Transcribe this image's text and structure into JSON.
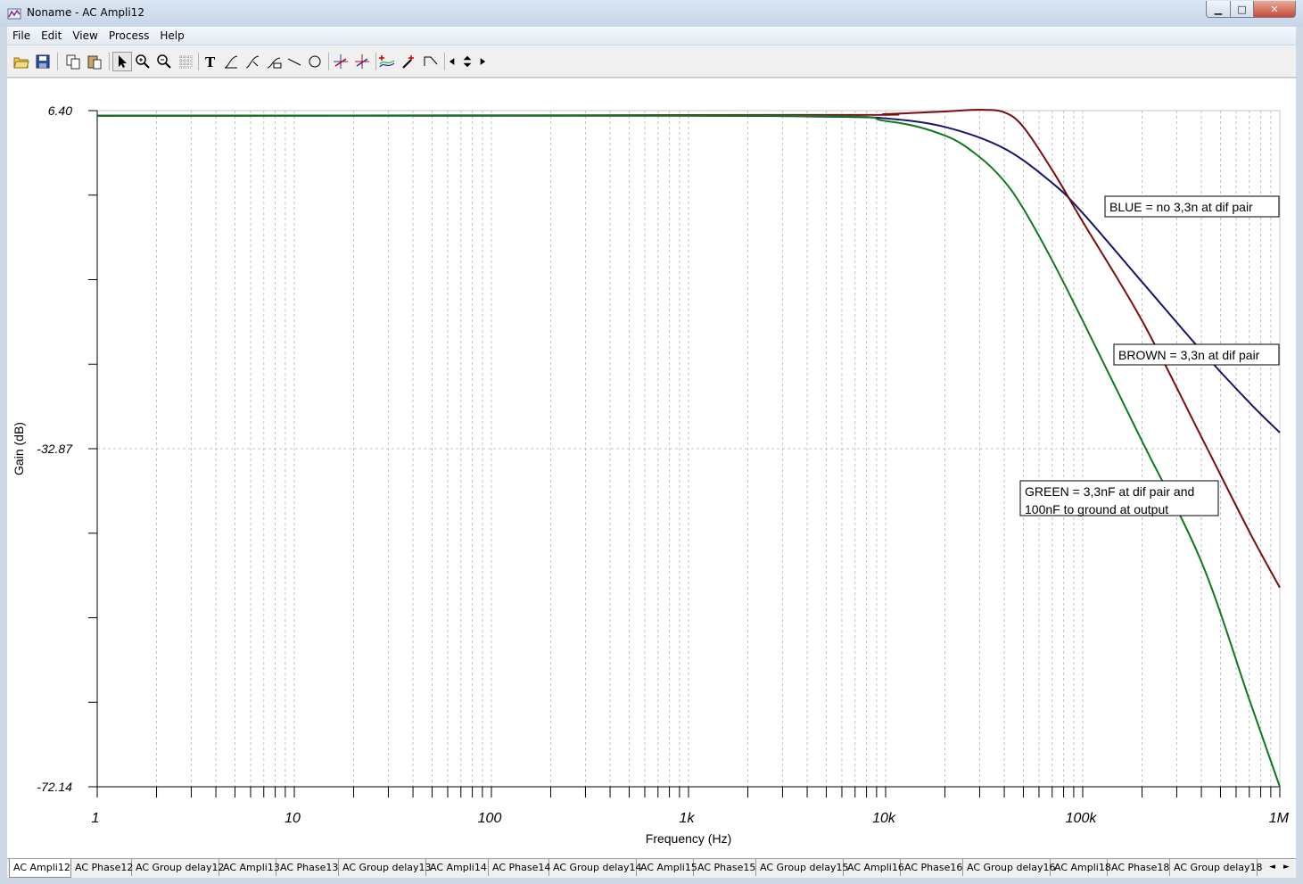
{
  "window": {
    "title": "Noname - AC Ampli12"
  },
  "menu": [
    "File",
    "Edit",
    "View",
    "Process",
    "Help"
  ],
  "toolbar_icons": [
    "open-file-icon",
    "save-icon",
    "copy-icon",
    "paste-icon",
    "select-arrow-icon",
    "zoom-in-icon",
    "zoom-out-icon",
    "grid-icon",
    "text-tool-icon",
    "curve-tool-icon",
    "curve-label-icon",
    "axis-label-icon",
    "line-tool-icon",
    "ellipse-tool-icon",
    "cursor-a-icon",
    "cursor-b-icon",
    "add-curves-icon",
    "probe-icon",
    "step-icon",
    "prev-icon",
    "up-down-icon",
    "next-icon"
  ],
  "chart_data": {
    "type": "line",
    "x_scale": "log",
    "xlabel": "Frequency (Hz)",
    "ylabel": "Gain (dB)",
    "xlim": [
      1,
      1000000
    ],
    "ylim": [
      -72.14,
      6.4
    ],
    "x_tick_labels": [
      "1",
      "10",
      "100",
      "1k",
      "10k",
      "100k",
      "1M"
    ],
    "x_tick_values": [
      1,
      10,
      100,
      1000,
      10000,
      100000,
      1000000
    ],
    "y_tick_labels": [
      "6.40",
      "-32.87",
      "-72.14"
    ],
    "y_tick_values": [
      6.4,
      -32.87,
      -72.14
    ],
    "grid": true,
    "series": [
      {
        "name": "",
        "color": "#14146e",
        "x": [
          1,
          1000,
          5000,
          10000,
          20000,
          40000,
          70000,
          100000,
          200000,
          400000,
          700000,
          1000000
        ],
        "y": [
          5.8,
          5.8,
          5.7,
          5.5,
          4.5,
          2.0,
          -2.0,
          -5.5,
          -13.5,
          -21.5,
          -27.5,
          -31.0
        ]
      },
      {
        "name": "",
        "color": "#7a0e0e",
        "x": [
          1,
          5000,
          10000,
          20000,
          30000,
          40000,
          50000,
          70000,
          100000,
          200000,
          400000,
          700000,
          1000000
        ],
        "y": [
          5.8,
          5.9,
          6.0,
          6.3,
          6.5,
          6.2,
          4.5,
          -0.5,
          -6.5,
          -18.0,
          -31.5,
          -42.5,
          -49.0
        ]
      },
      {
        "name": "",
        "color": "#0e7a1e",
        "x": [
          1,
          3000,
          10000,
          20000,
          30000,
          40000,
          50000,
          70000,
          100000,
          200000,
          400000,
          700000,
          1000000
        ],
        "y": [
          5.8,
          5.8,
          5.2,
          3.5,
          1.0,
          -1.8,
          -5.0,
          -11.0,
          -18.0,
          -32.0,
          -46.0,
          -62.0,
          -72.14
        ]
      }
    ],
    "annotations": [
      {
        "lines": [
          "BLUE = no 3,3n at dif pair"
        ]
      },
      {
        "lines": [
          "BROWN = 3,3n at dif pair"
        ]
      },
      {
        "lines": [
          "GREEN = 3,3nF at dif pair and",
          " 100nF to ground at output"
        ]
      }
    ]
  },
  "tabs": [
    "AC Ampli12",
    "AC Phase12",
    "AC Group delay12",
    "AC Ampli13",
    "AC Phase13",
    "AC Group delay13",
    "AC Ampli14",
    "AC Phase14",
    "AC Group delay14",
    "AC Ampli15",
    "AC Phase15",
    "AC Group delay15",
    "AC Ampli16",
    "AC Phase16",
    "AC Group delay16",
    "AC Ampli18",
    "AC Phase18",
    "AC Group delay18"
  ],
  "active_tab": "AC Ampli12",
  "tab_scroll": {
    "left": "◄",
    "right": "►"
  }
}
